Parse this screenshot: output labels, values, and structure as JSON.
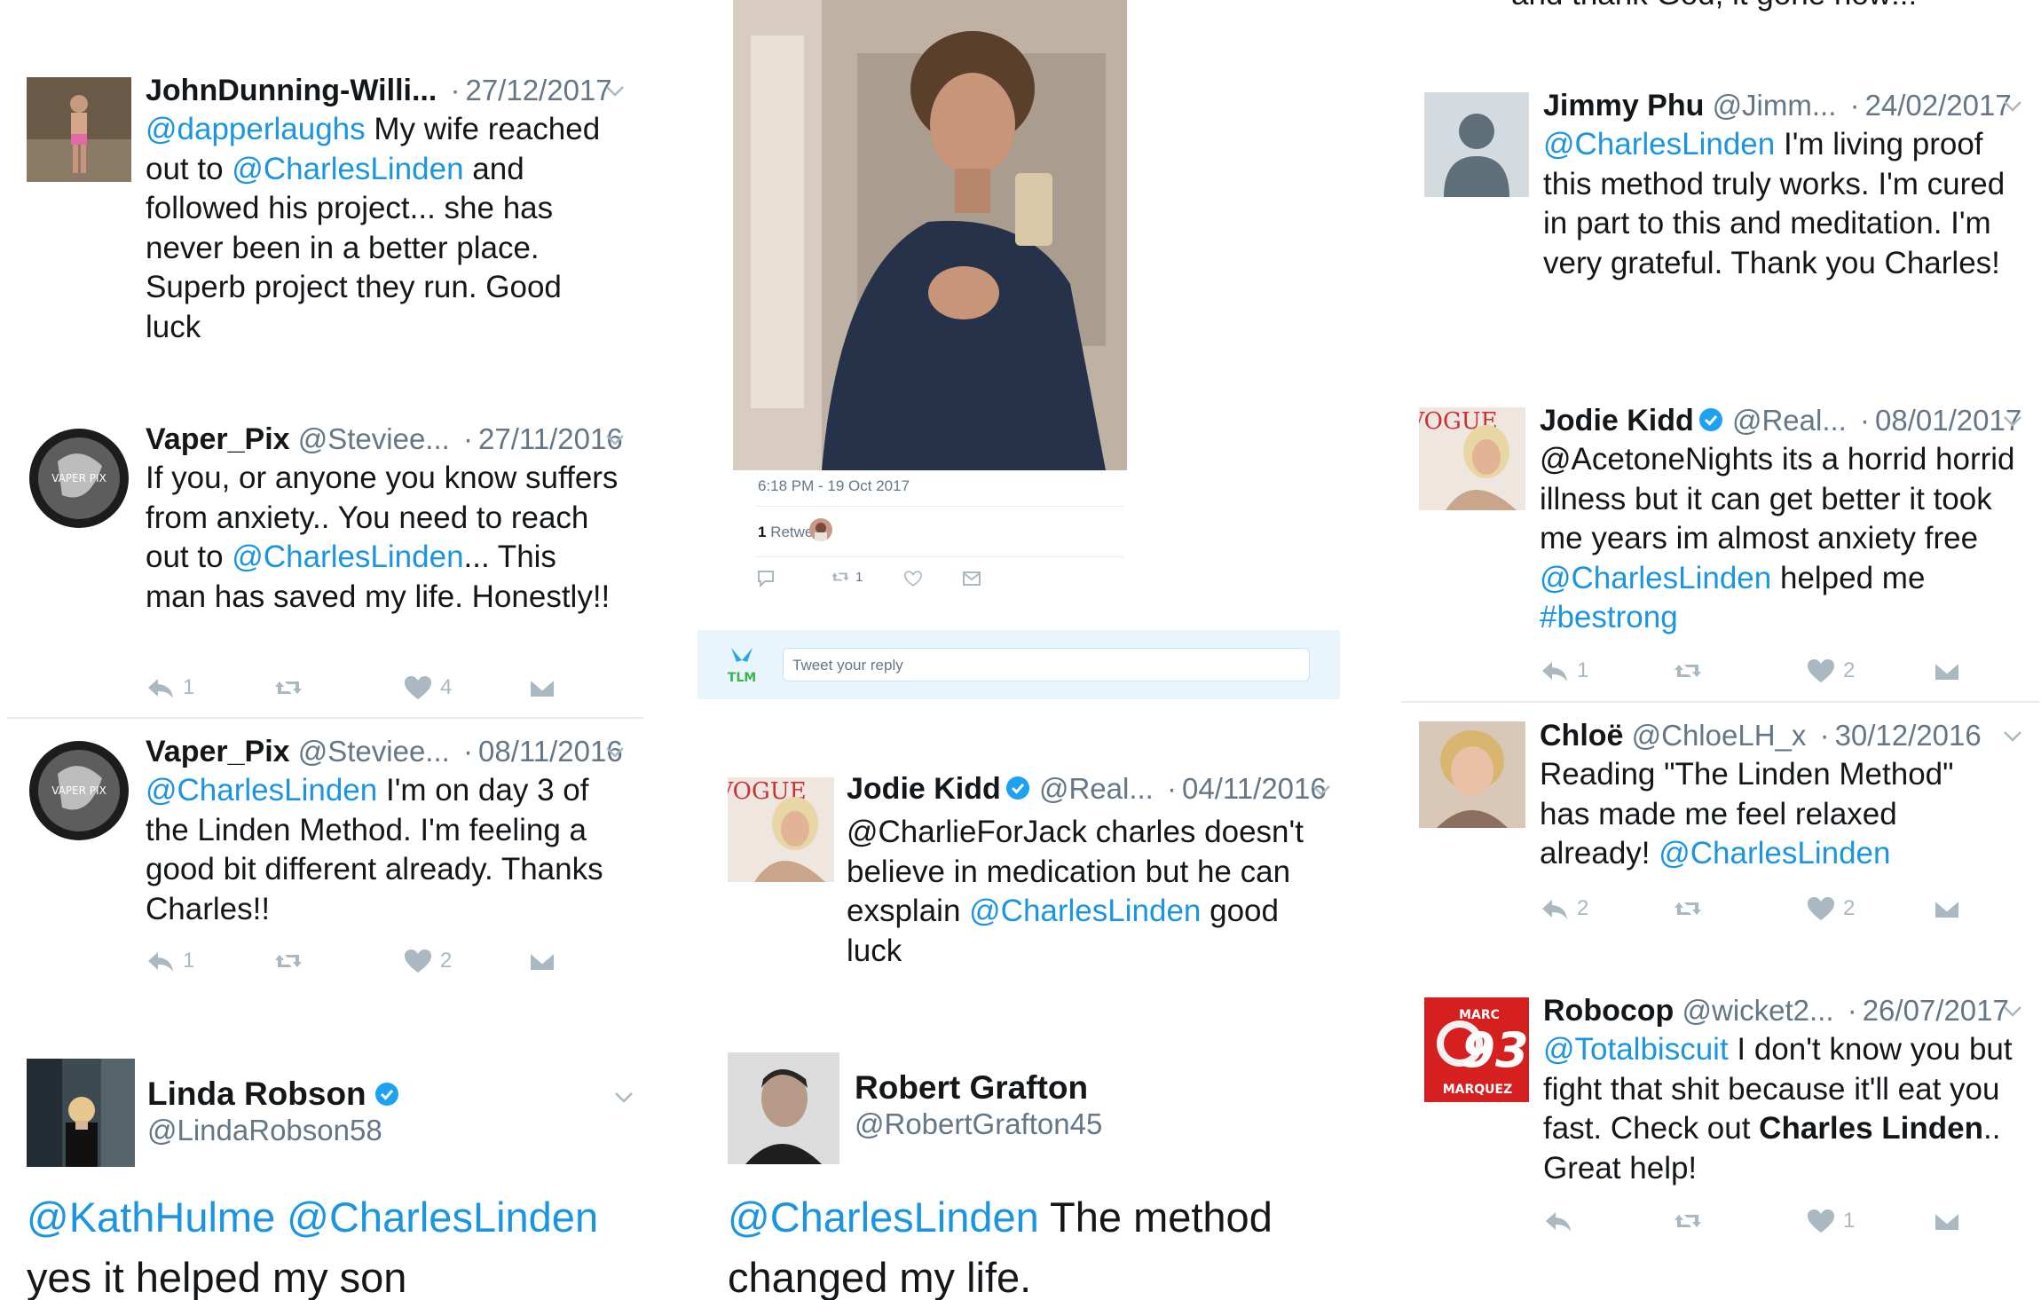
{
  "colors": {
    "link": "#1b95e0",
    "verified": "#1da1f2",
    "muted": "#657786",
    "icon": "#aab8c2",
    "reply_bar": "#e8f5fd"
  },
  "left": {
    "t1": {
      "name": "JohnDunning-Willi...",
      "date": "27/12/2017",
      "mention1": "@dapperlaughs",
      "text1": " My wife reached out to ",
      "mention2": "@CharlesLinden",
      "text2": " and followed his project... she has never been in a better place. Superb project they run. Good luck"
    },
    "t2": {
      "name": "Vaper_Pix",
      "handle": "@Steviee...",
      "date": "27/11/2016",
      "text1": "If you, or anyone you know suffers from anxiety.. You need to reach out to ",
      "mention1": "@CharlesLinden",
      "text2": "... This man has saved my life. Honestly!!",
      "replies": "1",
      "likes": "4"
    },
    "t3": {
      "name": "Vaper_Pix",
      "handle": "@Steviee...",
      "date": "08/11/2016",
      "mention1": "@CharlesLinden",
      "text1": " I'm on day 3 of the Linden Method. I'm feeling a good bit different already. Thanks Charles!!",
      "replies": "1",
      "likes": "2"
    },
    "t4": {
      "name": "Linda Robson",
      "handle": "@LindaRobson58",
      "mention1": "@KathHulme",
      "mention2": "@CharlesLinden",
      "text1": "  yes it helped my son"
    }
  },
  "middle": {
    "photo_meta": {
      "timestamp": "6:18 PM - 19 Oct 2017",
      "retweet_count": "1",
      "retweet_label": "Retweet",
      "rt_action_count": "1"
    },
    "reply_placeholder": "Tweet your reply",
    "t5": {
      "name": "Jodie Kidd",
      "handle": "@Real...",
      "date": "04/11/2016",
      "text1": "@CharlieForJack charles doesn't believe in medication but he can exsplain ",
      "mention1": "@CharlesLinden",
      "text2": " good luck"
    },
    "t6": {
      "name": "Robert Grafton",
      "handle": "@RobertGrafton45",
      "mention1": "@CharlesLinden",
      "text1": " The method changed my life."
    }
  },
  "right": {
    "top_cut": "and thank God, it gone now!!!",
    "t7": {
      "name": "Jimmy Phu",
      "handle": "@Jimm...",
      "date": "24/02/2017",
      "mention1": "@CharlesLinden",
      "text1": "  I'm living proof this method truly works. I'm cured in part to this and meditation. I'm very grateful. Thank you Charles!"
    },
    "t8": {
      "name": "Jodie Kidd",
      "handle": "@Real...",
      "date": "08/01/2017",
      "text1": "@AcetoneNights its a horrid horrid illness but it can get better it took me years im almost anxiety free ",
      "mention1": "@CharlesLinden",
      "text2": " helped me ",
      "hashtag": "#bestrong",
      "replies": "1",
      "likes": "2"
    },
    "t9": {
      "name": "Chloë",
      "handle": "@ChloeLH_x",
      "date": "30/12/2016",
      "text1": "Reading \"The Linden Method\" has made me feel relaxed already! ",
      "mention1": "@CharlesLinden",
      "replies": "2",
      "likes": "2"
    },
    "t10": {
      "name": "Robocop",
      "handle": "@wicket2...",
      "date": "26/07/2017",
      "mention1": "@Totalbiscuit",
      "text1": " I don't know you but fight that shit because it'll eat you fast. Check out ",
      "bold1": "Charles Linden",
      "text2": ".. Great help!",
      "likes": "1"
    }
  }
}
